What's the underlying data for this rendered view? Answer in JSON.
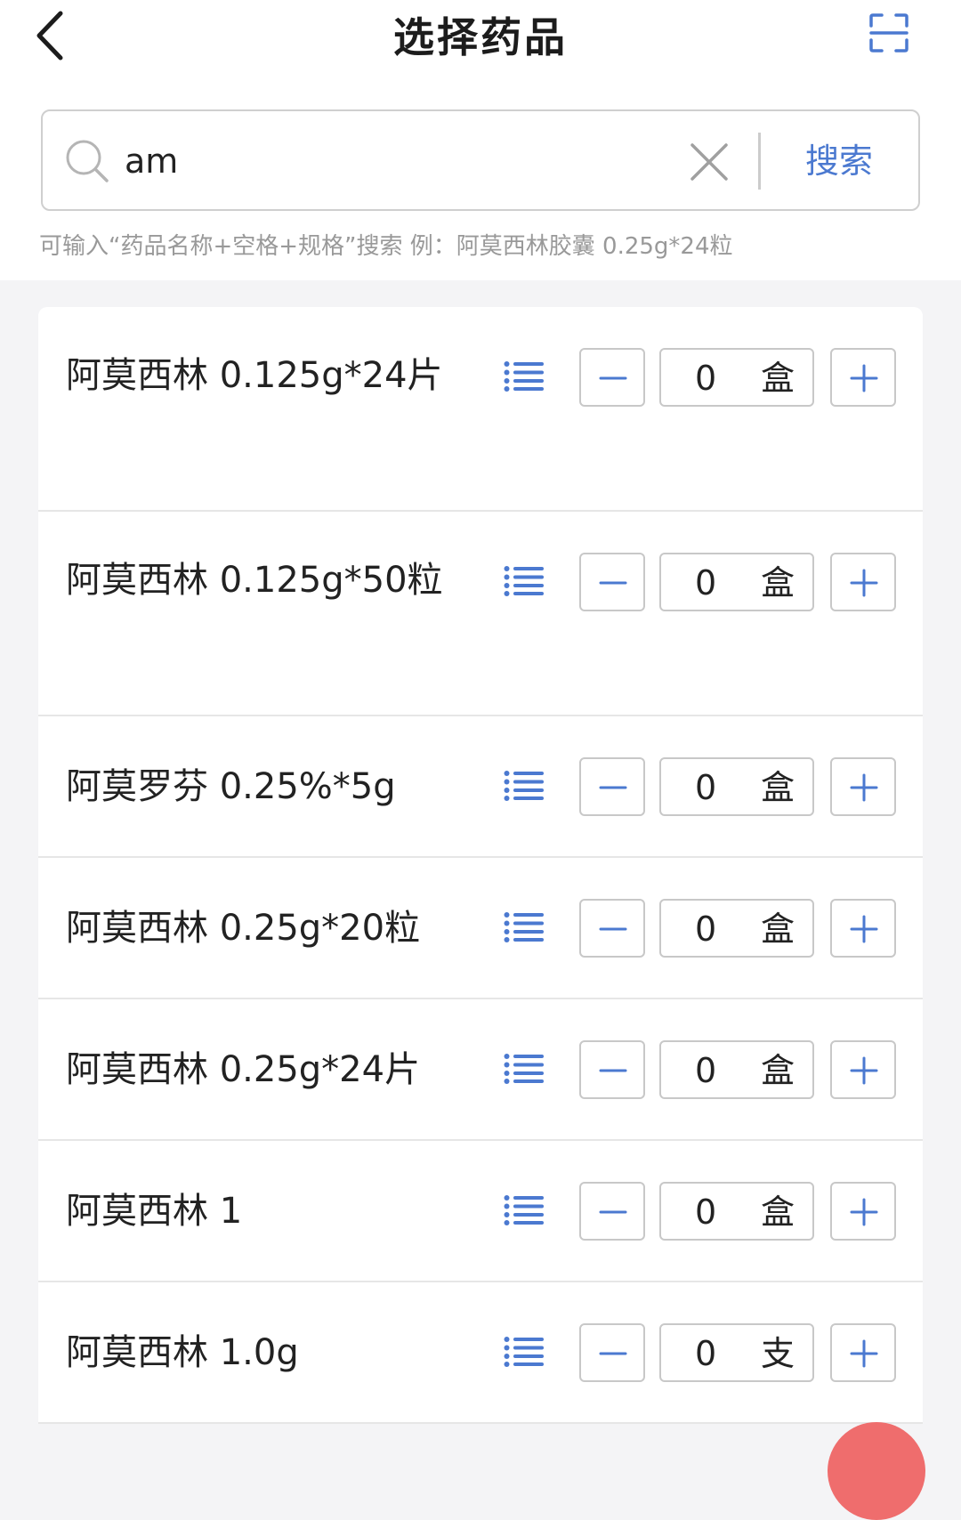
{
  "header": {
    "title": "选择药品"
  },
  "search": {
    "value": "am",
    "button_label": "搜索",
    "hint": "可输入“药品名称+空格+规格”搜索 例：阿莫西林胶囊 0.25g*24粒"
  },
  "colors": {
    "accent": "#4b79d0",
    "border": "#c8c8c8",
    "hint": "#999999",
    "page_bg": "#f4f4f6"
  },
  "drugs": [
    {
      "name": "阿莫西林 0.125g*24片",
      "qty": "0",
      "unit": "盒"
    },
    {
      "name": "阿莫西林 0.125g*50粒",
      "qty": "0",
      "unit": "盒"
    },
    {
      "name": "阿莫罗芬 0.25%*5g",
      "qty": "0",
      "unit": "盒"
    },
    {
      "name": "阿莫西林 0.25g*20粒",
      "qty": "0",
      "unit": "盒"
    },
    {
      "name": "阿莫西林 0.25g*24片",
      "qty": "0",
      "unit": "盒"
    },
    {
      "name": "阿莫西林 1",
      "qty": "0",
      "unit": "盒"
    },
    {
      "name": "阿莫西林 1.0g",
      "qty": "0",
      "unit": "支"
    }
  ]
}
